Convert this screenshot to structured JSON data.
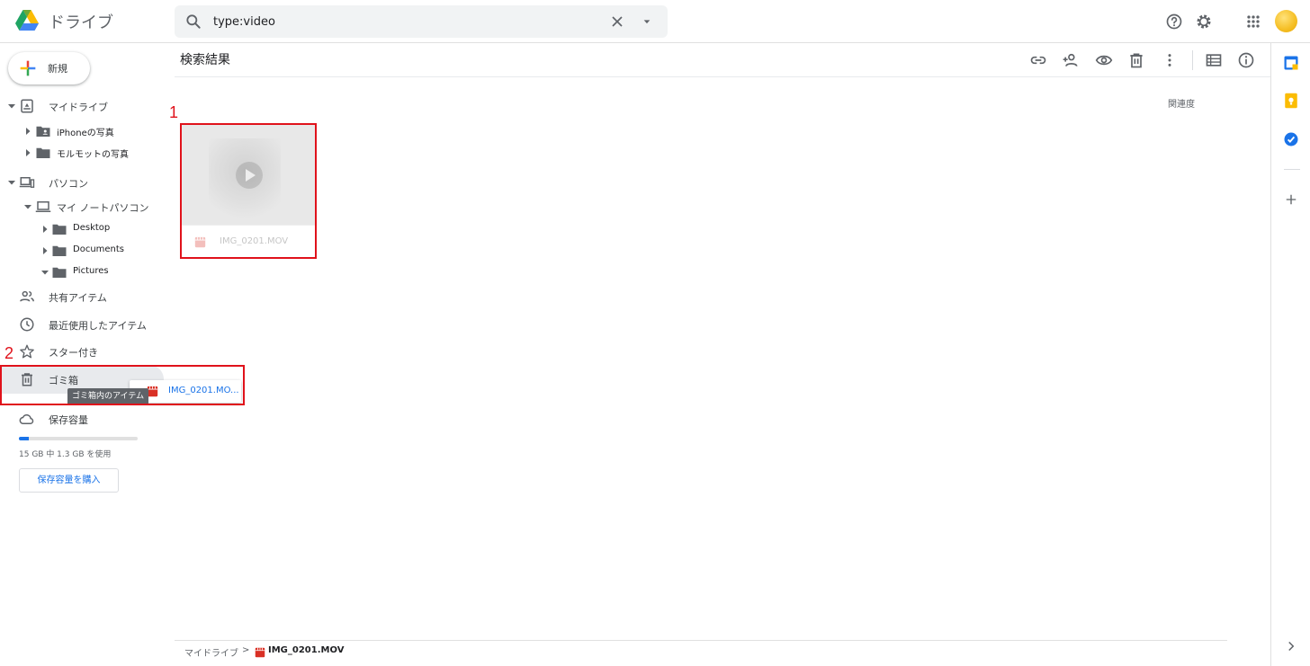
{
  "app": {
    "title": "ドライブ"
  },
  "search": {
    "query": "type:video"
  },
  "sidebar": {
    "new_label": "新規",
    "my_drive": "マイドライブ",
    "my_drive_children": [
      "iPhoneの写真",
      "モルモットの写真"
    ],
    "computers": "パソコン",
    "laptop": "マイ ノートパソコン",
    "laptop_children": [
      "Desktop",
      "Documents",
      "Pictures"
    ],
    "shared": "共有アイテム",
    "recent": "最近使用したアイテム",
    "starred": "スター付き",
    "trash": "ゴミ箱",
    "trash_tooltip": "ゴミ箱内のアイテム",
    "storage_label": "保存容量",
    "storage_used": "15 GB 中 1.3 GB を使用",
    "storage_fraction": 0.087,
    "buy_storage": "保存容量を購入"
  },
  "drag": {
    "file_name": "IMG_0201.MO..."
  },
  "main": {
    "title": "検索結果",
    "sort_label": "関連度",
    "file": {
      "name": "IMG_0201.MOV",
      "type": "video"
    }
  },
  "annotations": {
    "first": "1",
    "second": "2"
  },
  "breadcrumb": {
    "root": "マイドライブ",
    "separator": ">",
    "file": "IMG_0201.MOV"
  },
  "colors": {
    "accent": "#1a73e8",
    "annotation": "#e0121b",
    "video_icon": "#d93025"
  }
}
